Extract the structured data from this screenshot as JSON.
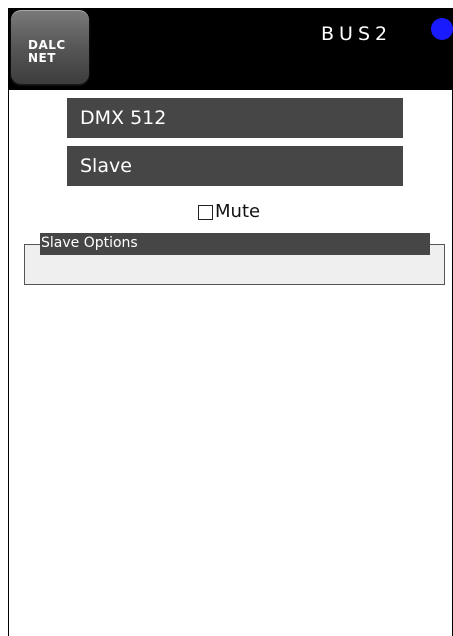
{
  "header": {
    "logo_line1": "DALC",
    "logo_line2": "NET",
    "title": "BUS2",
    "status_color": "#1a1aff"
  },
  "protocol_select": {
    "value": "DMX 512"
  },
  "mode_select": {
    "value": "Slave"
  },
  "mute": {
    "label": "Mute",
    "checked": false
  },
  "options_group": {
    "legend": "Slave Options"
  },
  "colors": {
    "header_bg": "#000000",
    "control_bg": "#464646",
    "group_bg": "#efefef"
  }
}
